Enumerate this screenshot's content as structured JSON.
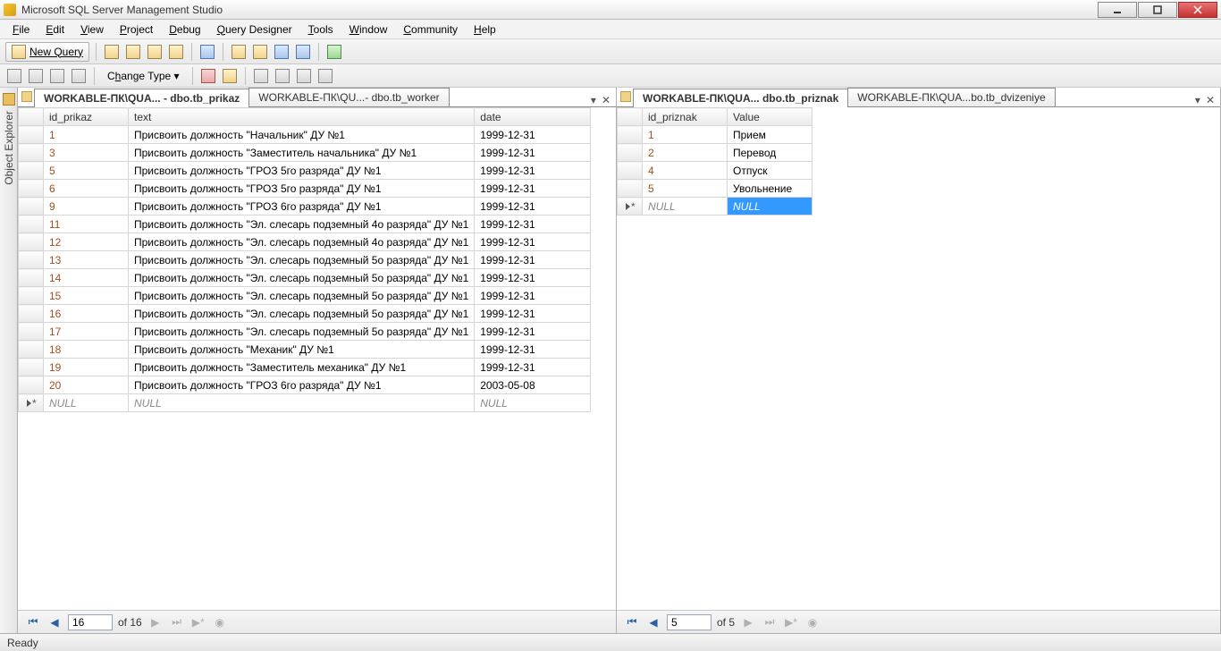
{
  "title": "Microsoft SQL Server Management Studio",
  "menu": {
    "file": "File",
    "edit": "Edit",
    "view": "View",
    "project": "Project",
    "debug": "Debug",
    "query": "Query Designer",
    "tools": "Tools",
    "window": "Window",
    "community": "Community",
    "help": "Help"
  },
  "toolbar": {
    "new_query": "New Query",
    "change_type": "Change Type"
  },
  "object_explorer": {
    "label": "Object Explorer"
  },
  "left_pane": {
    "tabs": [
      {
        "label": "WORKABLE-ПК\\QUA... - dbo.tb_prikaz",
        "active": true
      },
      {
        "label": "WORKABLE-ПК\\QU...- dbo.tb_worker",
        "active": false
      }
    ],
    "columns": [
      "id_prikaz",
      "text",
      "date"
    ],
    "rows": [
      {
        "id": "1",
        "text": "Присвоить должность \"Начальник\" ДУ №1",
        "date": "1999-12-31"
      },
      {
        "id": "3",
        "text": "Присвоить должность \"Заместитель начальника\" ДУ №1",
        "date": "1999-12-31"
      },
      {
        "id": "5",
        "text": "Присвоить должность \"ГРОЗ 5го разряда\" ДУ №1",
        "date": "1999-12-31"
      },
      {
        "id": "6",
        "text": "Присвоить должность \"ГРОЗ 5го разряда\" ДУ №1",
        "date": "1999-12-31"
      },
      {
        "id": "9",
        "text": "Присвоить должность \"ГРОЗ 6го разряда\" ДУ №1",
        "date": "1999-12-31"
      },
      {
        "id": "11",
        "text": "Присвоить должность \"Эл. слесарь подземный 4о разряда\" ДУ №1",
        "date": "1999-12-31"
      },
      {
        "id": "12",
        "text": "Присвоить должность \"Эл. слесарь подземный 4о разряда\" ДУ №1",
        "date": "1999-12-31"
      },
      {
        "id": "13",
        "text": "Присвоить должность \"Эл. слесарь подземный 5о разряда\" ДУ №1",
        "date": "1999-12-31"
      },
      {
        "id": "14",
        "text": "Присвоить должность \"Эл. слесарь подземный 5о разряда\" ДУ №1",
        "date": "1999-12-31"
      },
      {
        "id": "15",
        "text": "Присвоить должность \"Эл. слесарь подземный 5о разряда\" ДУ №1",
        "date": "1999-12-31"
      },
      {
        "id": "16",
        "text": "Присвоить должность \"Эл. слесарь подземный 5о разряда\" ДУ №1",
        "date": "1999-12-31"
      },
      {
        "id": "17",
        "text": "Присвоить должность \"Эл. слесарь подземный 5о разряда\" ДУ №1",
        "date": "1999-12-31"
      },
      {
        "id": "18",
        "text": "Присвоить должность \"Механик\" ДУ №1",
        "date": "1999-12-31"
      },
      {
        "id": "19",
        "text": "Присвоить должность \"Заместитель механика\" ДУ №1",
        "date": "1999-12-31"
      },
      {
        "id": "20",
        "text": "Присвоить должность \"ГРОЗ 6го разряда\" ДУ №1",
        "date": "2003-05-08"
      }
    ],
    "null_label": "NULL",
    "nav": {
      "pos": "16",
      "of": "of 16"
    }
  },
  "right_pane": {
    "tabs": [
      {
        "label": "WORKABLE-ПК\\QUA... dbo.tb_priznak",
        "active": true
      },
      {
        "label": "WORKABLE-ПК\\QUA...bo.tb_dvizeniye",
        "active": false
      }
    ],
    "columns": [
      "id_priznak",
      "Value"
    ],
    "rows": [
      {
        "id": "1",
        "value": "Прием"
      },
      {
        "id": "2",
        "value": "Перевод"
      },
      {
        "id": "4",
        "value": "Отпуск"
      },
      {
        "id": "5",
        "value": "Увольнение"
      }
    ],
    "null_label": "NULL",
    "nav": {
      "pos": "5",
      "of": "of 5"
    }
  },
  "status": {
    "ready": "Ready"
  }
}
